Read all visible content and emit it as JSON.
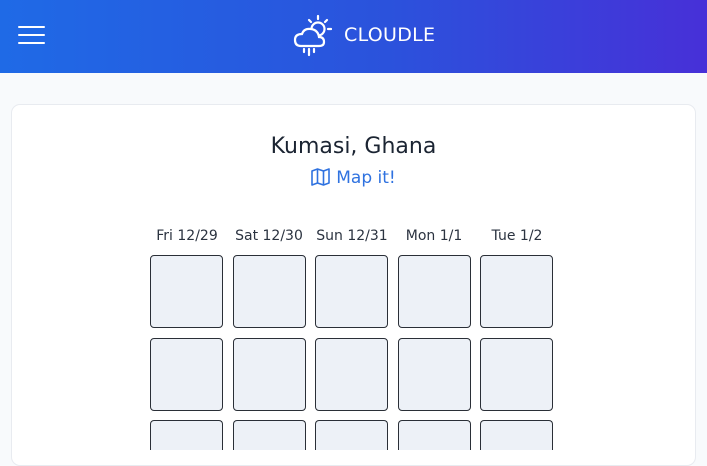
{
  "header": {
    "menu_icon": "hamburger-menu-icon",
    "logo_icon": "sun-cloud-rain-icon",
    "app_name": "CLOUDLE",
    "gradient": [
      "#1f6ae6",
      "#4730d8"
    ]
  },
  "location": {
    "city": "Kumasi, Ghana",
    "map_link": "Map it!",
    "map_icon": "map-icon"
  },
  "forecast": {
    "days": [
      "Fri 12/29",
      "Sat 12/30",
      "Sun 12/31",
      "Mon 1/1",
      "Tue 1/2"
    ]
  },
  "colors": {
    "link": "#2f72e0",
    "tile_fill": "#edf1f7",
    "tile_border": "#2a2f37"
  }
}
